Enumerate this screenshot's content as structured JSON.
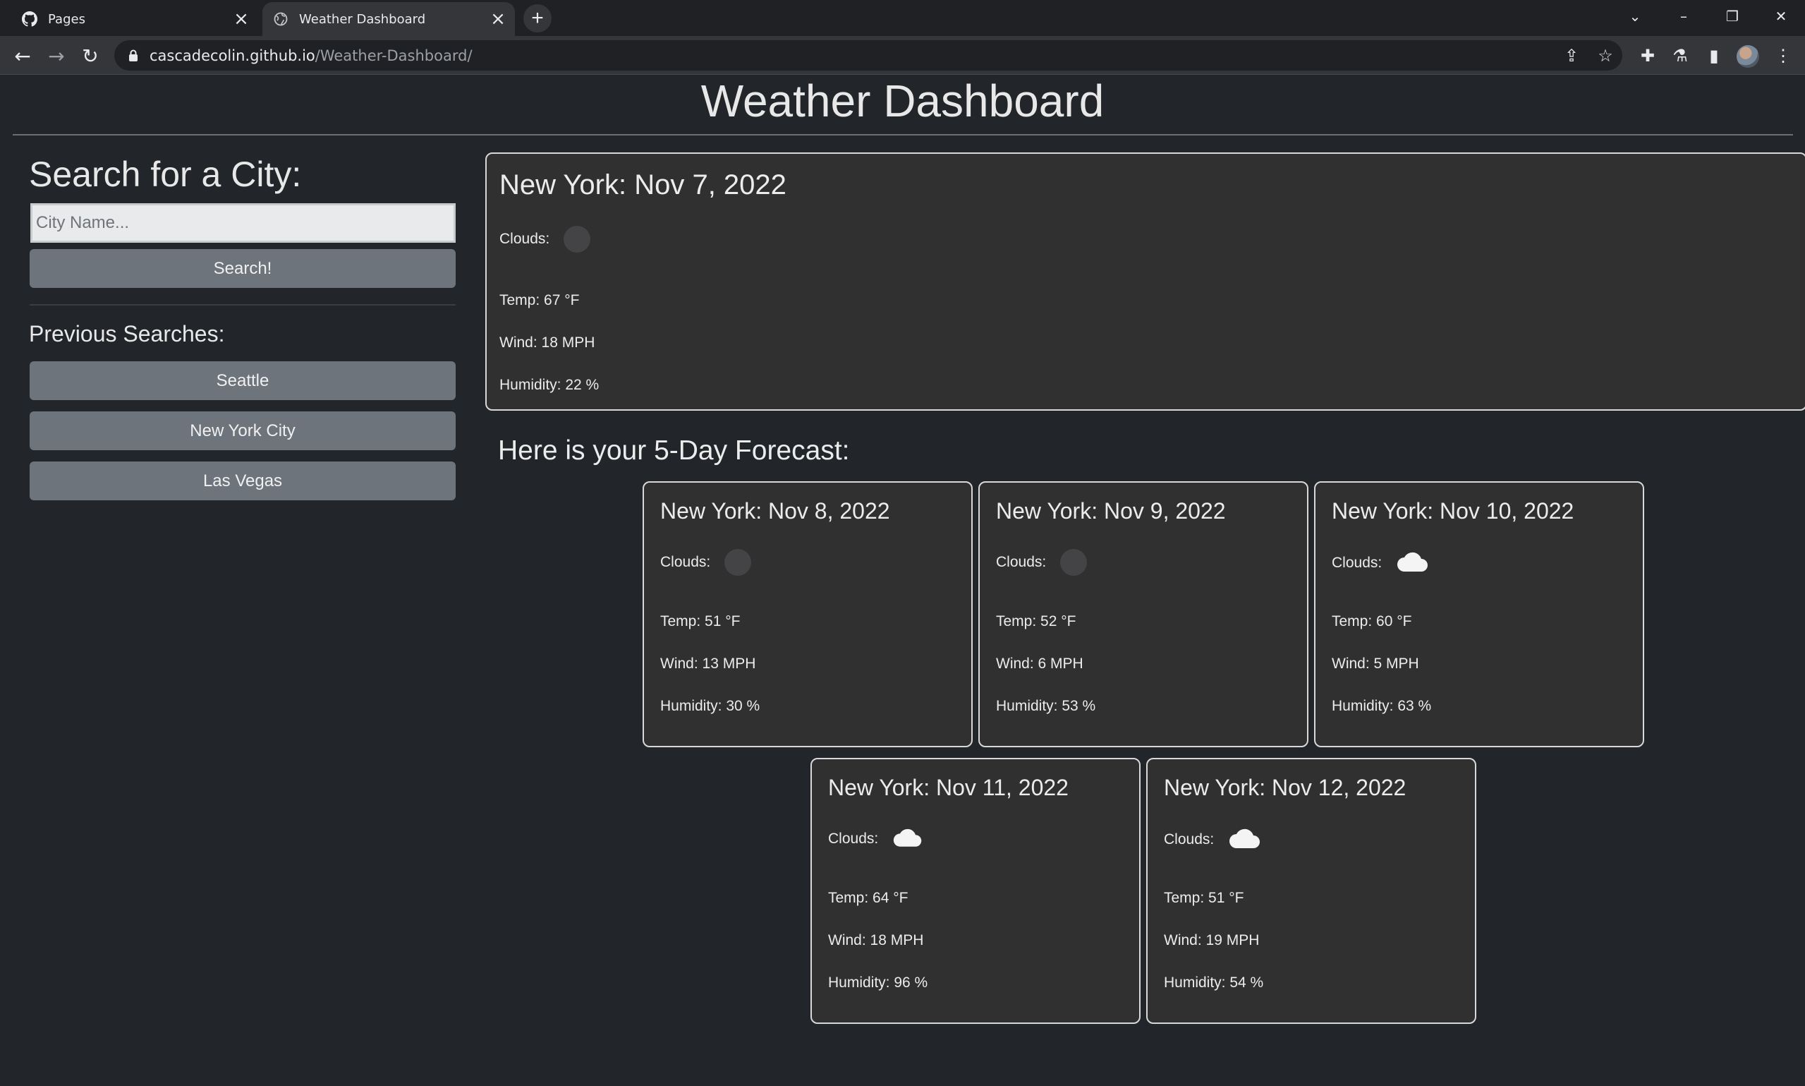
{
  "browser": {
    "tabs": [
      {
        "title": "Pages",
        "icon": "github-icon",
        "active": false
      },
      {
        "title": "Weather Dashboard",
        "icon": "globe-icon",
        "active": true
      }
    ],
    "url_host": "cascadecolin.github.io",
    "url_path": "/Weather-Dashboard/"
  },
  "app": {
    "title": "Weather Dashboard",
    "search_heading": "Search for a City:",
    "search_placeholder": "City Name...",
    "search_button": "Search!",
    "previous_heading": "Previous Searches:",
    "previous_searches": [
      "Seattle",
      "New York City",
      "Las Vegas"
    ]
  },
  "current": {
    "title": "New York: Nov 7, 2022",
    "clouds_label": "Clouds:",
    "clouds_icon": "clouds-empty",
    "temp": "Temp: 67 °F",
    "wind": "Wind: 18 MPH",
    "humidity": "Humidity: 22 %"
  },
  "forecast_heading": "Here is your 5-Day Forecast:",
  "forecast": [
    {
      "title": "New York: Nov 8, 2022",
      "clouds_label": "Clouds:",
      "clouds_icon": "clouds-empty",
      "temp": "Temp: 51 °F",
      "wind": "Wind: 13 MPH",
      "humidity": "Humidity: 30 %"
    },
    {
      "title": "New York: Nov 9, 2022",
      "clouds_label": "Clouds:",
      "clouds_icon": "clouds-empty",
      "temp": "Temp: 52 °F",
      "wind": "Wind: 6 MPH",
      "humidity": "Humidity: 53 %"
    },
    {
      "title": "New York: Nov 10, 2022",
      "clouds_label": "Clouds:",
      "clouds_icon": "cloud-icon",
      "temp": "Temp: 60 °F",
      "wind": "Wind: 5 MPH",
      "humidity": "Humidity: 63 %"
    },
    {
      "title": "New York: Nov 11, 2022",
      "clouds_label": "Clouds:",
      "clouds_icon": "cloud-icon",
      "temp": "Temp: 64 °F",
      "wind": "Wind: 18 MPH",
      "humidity": "Humidity: 96 %"
    },
    {
      "title": "New York: Nov 12, 2022",
      "clouds_label": "Clouds:",
      "clouds_icon": "cloud-icon",
      "temp": "Temp: 51 °F",
      "wind": "Wind: 19 MPH",
      "humidity": "Humidity: 54 %"
    }
  ]
}
